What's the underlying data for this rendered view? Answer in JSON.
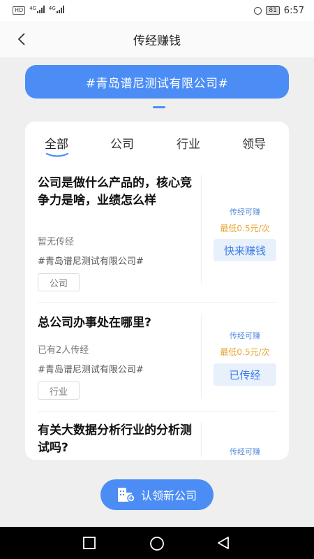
{
  "status_bar": {
    "hd": "HD",
    "net1": "4G",
    "net2": "4G",
    "battery": "81",
    "time": "6:57"
  },
  "nav": {
    "title": "传经赚钱"
  },
  "banner": {
    "company": "#青岛谱尼测试有限公司#"
  },
  "tabs": [
    {
      "label": "全部"
    },
    {
      "label": "公司"
    },
    {
      "label": "行业"
    },
    {
      "label": "领导"
    }
  ],
  "questions": [
    {
      "title": "公司是做什么产品的，核心竞争力是啥，业绩怎么样",
      "status": "暂无传经",
      "company": "#青岛谱尼测试有限公司#",
      "tag": "公司",
      "earn_label": "传经可赚",
      "earn_price": "最低0.5元/次",
      "button": "快来赚钱"
    },
    {
      "title": "总公司办事处在哪里?",
      "status": "已有2人传经",
      "company": "#青岛谱尼测试有限公司#",
      "tag": "行业",
      "earn_label": "传经可赚",
      "earn_price": "最低0.5元/次",
      "button": "已传经"
    },
    {
      "title": "有关大数据分析行业的分析测试吗?",
      "earn_label": "传经可赚"
    }
  ],
  "claim_button": {
    "label": "认领新公司"
  },
  "colors": {
    "accent": "#4b8df5",
    "price": "#e8a531",
    "button_bg": "#e8f0fc"
  }
}
